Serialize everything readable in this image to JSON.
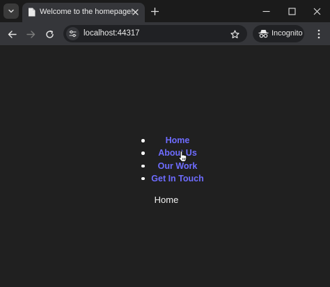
{
  "browser": {
    "tab": {
      "title": "Welcome to the homepage!"
    },
    "address_bar": {
      "url": "localhost:44317"
    },
    "incognito_label": "Incognito"
  },
  "page": {
    "nav_links": [
      {
        "label": "Home"
      },
      {
        "label": "About Us"
      },
      {
        "label": "Our Work"
      },
      {
        "label": "Get In Touch"
      }
    ],
    "current_section": "Home"
  },
  "colors": {
    "link": "#6e6cff",
    "page_background": "#202020",
    "toolbar": "#35363a"
  }
}
